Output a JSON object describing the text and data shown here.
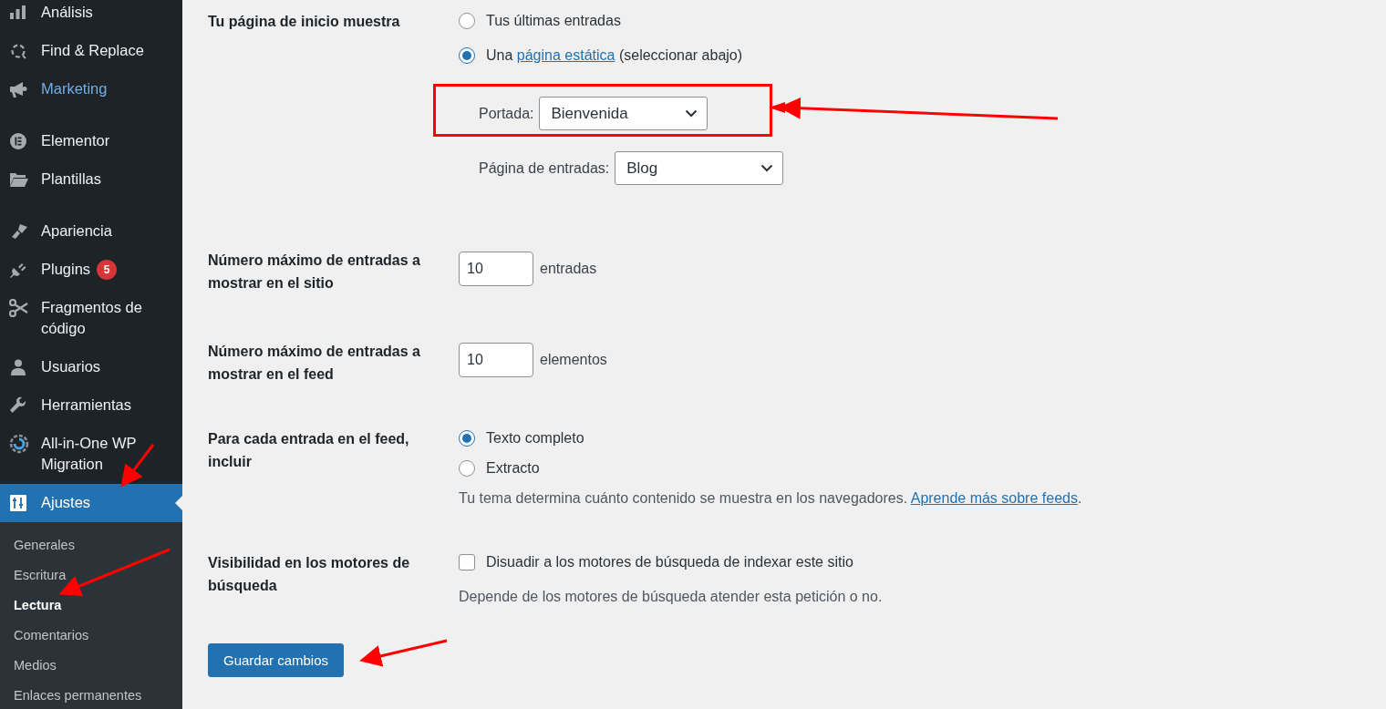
{
  "sidebar": {
    "groups": [
      {
        "items": [
          {
            "label": "Análisis",
            "highlighted": false,
            "selected": false
          },
          {
            "label": "Find & Replace",
            "highlighted": false,
            "selected": false
          },
          {
            "label": "Marketing",
            "highlighted": true,
            "selected": false
          }
        ]
      },
      {
        "items": [
          {
            "label": "Elementor",
            "highlighted": false,
            "selected": false
          },
          {
            "label": "Plantillas",
            "highlighted": false,
            "selected": false
          }
        ]
      },
      {
        "items": [
          {
            "label": "Apariencia",
            "highlighted": false,
            "selected": false
          },
          {
            "label": "Plugins",
            "highlighted": false,
            "selected": false,
            "badge": "5"
          },
          {
            "label": "Fragmentos de código",
            "highlighted": false,
            "selected": false
          },
          {
            "label": "Usuarios",
            "highlighted": false,
            "selected": false
          },
          {
            "label": "Herramientas",
            "highlighted": false,
            "selected": false
          },
          {
            "label": "All-in-One WP Migration",
            "highlighted": false,
            "selected": false
          },
          {
            "label": "Ajustes",
            "highlighted": false,
            "selected": true
          }
        ]
      }
    ],
    "submenu": [
      {
        "label": "Generales",
        "selected": false
      },
      {
        "label": "Escritura",
        "selected": false
      },
      {
        "label": "Lectura",
        "selected": true
      },
      {
        "label": "Comentarios",
        "selected": false
      },
      {
        "label": "Medios",
        "selected": false
      },
      {
        "label": "Enlaces permanentes",
        "selected": false
      }
    ]
  },
  "settings": [
    {
      "kind": "homepage",
      "label": "Tu página de inicio muestra",
      "options": [
        {
          "text": "Tus últimas entradas",
          "selected": false
        },
        {
          "text": "Una",
          "link": "página estática",
          "after": "(seleccionar abajo)",
          "selected": true
        }
      ],
      "selects": [
        {
          "label": "Portada:",
          "value": "Bienvenida"
        },
        {
          "label": "Página de entradas:",
          "value": "Blog"
        }
      ]
    },
    {
      "kind": "number",
      "label": "Número máximo de entradas a mostrar en el sitio",
      "value": "10",
      "unit": "entradas"
    },
    {
      "kind": "number",
      "label": "Número máximo de entradas a mostrar en el feed",
      "value": "10",
      "unit": "elementos"
    },
    {
      "kind": "radio",
      "label": "Para cada entrada en el feed, incluir",
      "options": [
        {
          "text": "Texto completo",
          "selected": true
        },
        {
          "text": "Extracto",
          "selected": false
        }
      ],
      "description": "Tu tema determina cuánto contenido se muestra en los navegadores.",
      "link": "Aprende más sobre feeds",
      "after": "."
    },
    {
      "kind": "checkbox",
      "label": "Visibilidad en los motores de búsqueda",
      "option": {
        "text": "Disuadir a los motores de búsqueda de indexar este sitio",
        "checked": false
      },
      "description": "Depende de los motores de búsqueda atender esta petición o no."
    }
  ],
  "save_button": "Guardar cambios"
}
